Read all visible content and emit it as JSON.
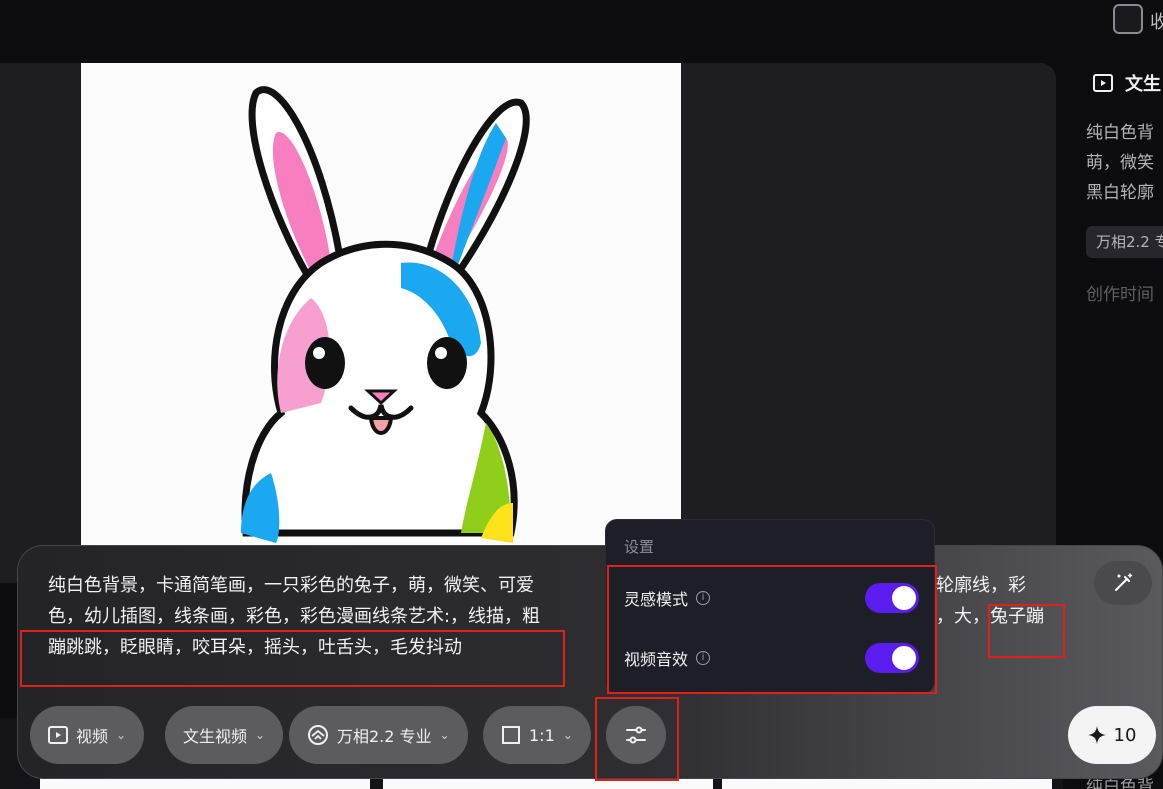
{
  "topbar": {
    "label": "收"
  },
  "right_panel": {
    "title": "文生",
    "description_lines": [
      "纯白色背",
      "萌，微笑",
      "黑白轮廓"
    ],
    "model_chip": "万相2.2 专",
    "time_label": "创作时间",
    "bottom_text": "纯白色背"
  },
  "prompt": {
    "lines": [
      "纯白色背景，卡通简笔画，一只彩色的兔子，萌，微笑、可爱",
      "色，幼儿插图，线条画，彩色，彩色漫画线条艺术:，线描，粗",
      "蹦跳跳，眨眼睛，咬耳朵，摇头，吐舌头，毛发抖动"
    ],
    "right_fragment_1": "轮廓线，彩",
    "right_fragment_2": "，大，",
    "right_fragment_2b": "兔子蹦"
  },
  "toolbar": {
    "mode_label": "视频",
    "type_label": "文生视频",
    "model_label": "万相2.2 专业",
    "ratio_label": "1:1",
    "generate_count": "10"
  },
  "settings": {
    "title": "设置",
    "inspiration_label": "灵感模式",
    "audio_label": "视频音效",
    "inspiration_on": true,
    "audio_on": true
  },
  "colors": {
    "toggle_on": "#5b1cf0",
    "highlight": "#e0201a"
  }
}
